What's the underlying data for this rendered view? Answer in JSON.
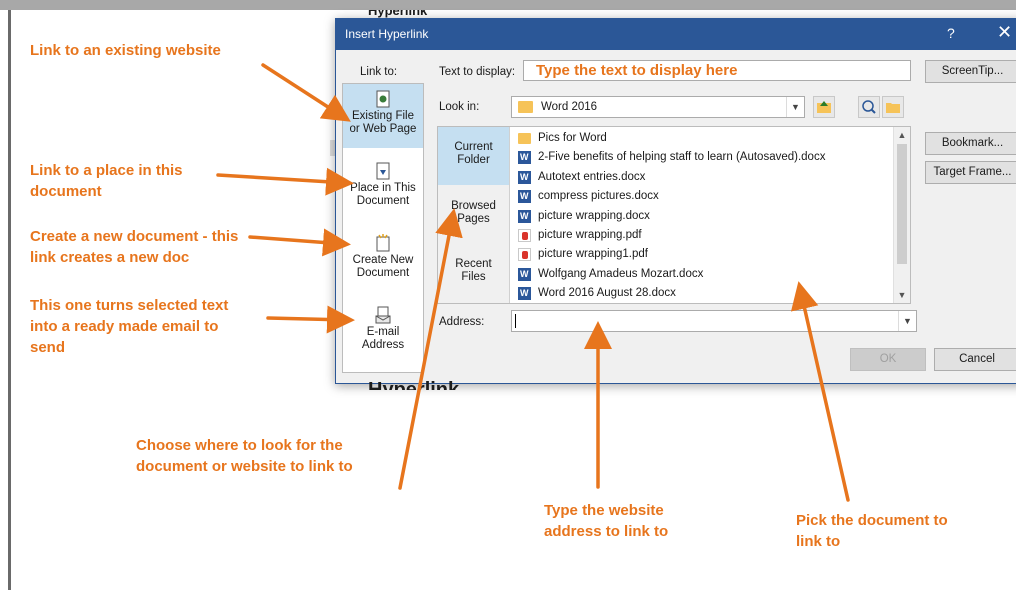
{
  "dialog": {
    "title": "Insert Hyperlink",
    "help": "?",
    "close": "✕",
    "link_to_label": "Link to:",
    "text_to_display_label": "Text to display:",
    "text_to_display_value": "Type the text to display here",
    "screentip_button": "ScreenTip...",
    "look_in_label": "Look in:",
    "look_in_value": "Word 2016",
    "bookmark_button": "Bookmark...",
    "target_frame_button": "Target Frame...",
    "address_label": "Address:",
    "ok_button": "OK",
    "cancel_button": "Cancel"
  },
  "nav": {
    "existing_line1": "Existing File",
    "existing_line2": "or Web Page",
    "place_line1": "Place in This",
    "place_line2": "Document",
    "create_line1": "Create New",
    "create_line2": "Document",
    "email_line1": "E-mail",
    "email_line2": "Address"
  },
  "browser_tabs": {
    "current_line1": "Current",
    "current_line2": "Folder",
    "browsed_line1": "Browsed",
    "browsed_line2": "Pages",
    "recent_line1": "Recent",
    "recent_line2": "Files"
  },
  "files": [
    {
      "name": "Pics for Word",
      "type": "folder"
    },
    {
      "name": "2-Five benefits of helping staff to learn (Autosaved).docx",
      "type": "word"
    },
    {
      "name": "Autotext entries.docx",
      "type": "word"
    },
    {
      "name": "compress pictures.docx",
      "type": "word"
    },
    {
      "name": "picture wrapping.docx",
      "type": "word"
    },
    {
      "name": "picture wrapping.pdf",
      "type": "pdf"
    },
    {
      "name": "picture wrapping1.pdf",
      "type": "pdf"
    },
    {
      "name": "Wolfgang Amadeus Mozart.docx",
      "type": "word"
    },
    {
      "name": "Word 2016 August 28.docx",
      "type": "word"
    }
  ],
  "annotations": {
    "a1": "Link to an existing website",
    "a2_line1": "Link to a place in this",
    "a2_line2": "document",
    "a3_line1": "Create a new document - this",
    "a3_line2": "link creates a new doc",
    "a4_line1": "This one turns selected text",
    "a4_line2": "into a ready made email to",
    "a4_line3": "send",
    "a5_line1": "Choose where to look for the",
    "a5_line2": "document or website to link to",
    "a6_line1": "Type the website",
    "a6_line2": "address to link to",
    "a7_line1": "Pick the document to",
    "a7_line2": "link to"
  },
  "background_doc": {
    "top_fragment": "Hyperlink",
    "bottom_fragment": "Hyperlink"
  },
  "colors": {
    "annotation": "#e7751d",
    "titlebar": "#2b5797",
    "selected": "#c5dff1"
  }
}
